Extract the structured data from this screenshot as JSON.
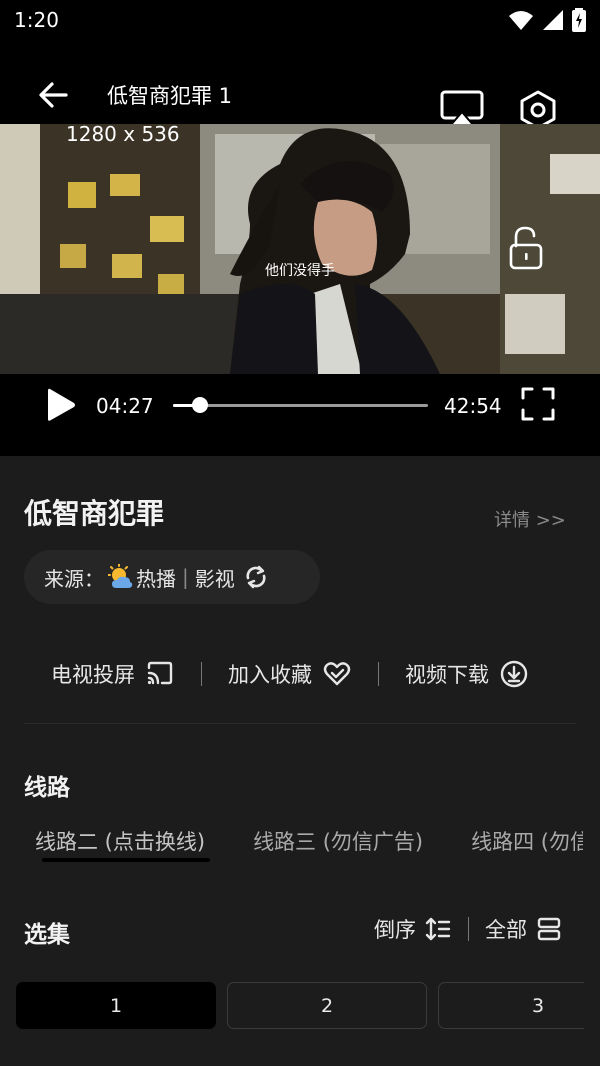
{
  "status_bar": {
    "time": "1:20"
  },
  "player": {
    "title": "低智商犯罪 1",
    "resolution": "1280 x 536",
    "subtitle": "他们没得手",
    "current_time": "04:27",
    "total_time": "42:54",
    "progress": 0.104
  },
  "show": {
    "title": "低智商犯罪",
    "details_link": "详情 >>",
    "source_label": "来源：",
    "source_name": "热播",
    "source_type": "影视"
  },
  "actions": {
    "cast": "电视投屏",
    "favorite": "加入收藏",
    "download": "视频下载"
  },
  "routes": {
    "title": "线路",
    "items": [
      "线路二 (点击换线)",
      "线路三 (勿信广告)",
      "线路四 (勿信广告)"
    ]
  },
  "episodes": {
    "title": "选集",
    "sort_label": "倒序",
    "all_label": "全部",
    "items": [
      "1",
      "2",
      "3"
    ]
  }
}
